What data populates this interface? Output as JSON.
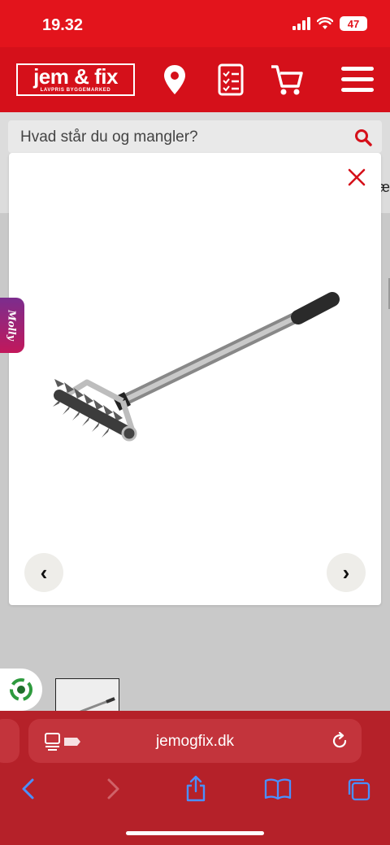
{
  "status": {
    "time": "19.32",
    "battery": "47"
  },
  "header": {
    "logo_main": "jem & fix",
    "logo_sub": "LAVPRIS BYGGEMARKED",
    "icons": [
      "location-pin-icon",
      "checklist-icon",
      "cart-icon",
      "menu-icon"
    ]
  },
  "search": {
    "placeholder": "Hvad står du og mangler?"
  },
  "background": {
    "peek_text": "æ"
  },
  "molly": {
    "label": "Molly"
  },
  "gallery": {
    "prev_label": "‹",
    "next_label": "›"
  },
  "browser": {
    "url": "jemogfix.dk"
  },
  "colors": {
    "brand_red": "#d5101a",
    "status_red": "#e3141c",
    "browser_red": "#b52129",
    "molly_purple": "#7b2d8e"
  }
}
